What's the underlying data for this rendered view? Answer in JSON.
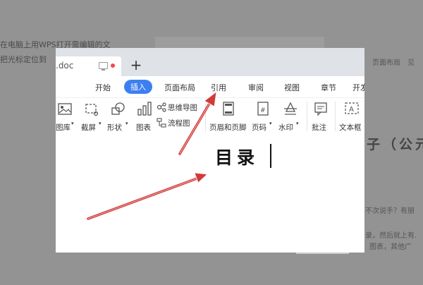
{
  "background": {
    "line1": "在电脑上用WPS打开需编辑的文",
    "line2": "把光标定位到",
    "right_heading": "子（公元",
    "right_text1": "不次说手？有朋",
    "right_text2": "录，然后就上有.",
    "right_text3": "图表，其他广",
    "right_top1": "页面布局",
    "right_top2": "见"
  },
  "tabbar": {
    "doc_tab_label": ".doc",
    "new_tab": "+"
  },
  "menu": {
    "items": [
      "开始",
      "插入",
      "页面布局",
      "引用",
      "审阅",
      "视图",
      "章节",
      "开发"
    ]
  },
  "ribbon": {
    "gallery": "图库",
    "screenshot": "截屏",
    "shapes": "形状",
    "chart": "图表",
    "mindmap": "思维导图",
    "flowchart": "流程图",
    "header_footer": "页眉和页脚",
    "page_number": "页码",
    "watermark": "水印",
    "comment": "批注",
    "textbox": "文本框",
    "dropdown_marker": "▾"
  },
  "document": {
    "title": "目录"
  },
  "colors": {
    "accent": "#3d7ff0",
    "arrow": "#d23a3a",
    "tab_dot": "#f04a4a"
  }
}
